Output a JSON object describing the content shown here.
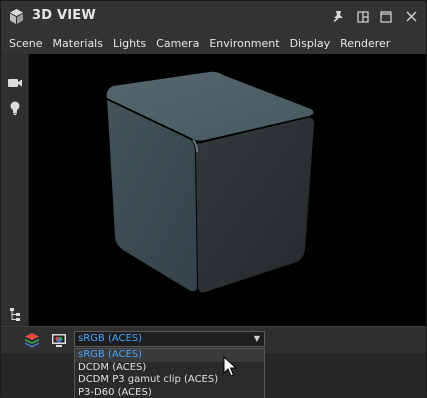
{
  "window": {
    "title": "3D VIEW",
    "title_icon": "cube-icon",
    "buttons": [
      "pin-icon",
      "layout-icon",
      "close-icon"
    ]
  },
  "menu": {
    "items": [
      "Scene",
      "Materials",
      "Lights",
      "Camera",
      "Environment",
      "Display",
      "Renderer"
    ]
  },
  "left_toolbar": {
    "icons": [
      "camera-icon",
      "light-bulb-icon",
      "hierarchy-icon"
    ]
  },
  "viewport": {
    "background": "#000000",
    "object": "cube",
    "object_color": "#46555d"
  },
  "bottom_bar": {
    "icons": [
      "layers-icon",
      "display-color-icon"
    ],
    "color_space_select": {
      "value": "sRGB (ACES)",
      "options": [
        "sRGB (ACES)",
        "DCDM (ACES)",
        "DCDM P3 gamut clip (ACES)",
        "P3-D60 (ACES)"
      ],
      "selected_index": 0
    }
  },
  "colors": {
    "accent": "#4aa3ff",
    "panel": "#2b2b2b"
  }
}
